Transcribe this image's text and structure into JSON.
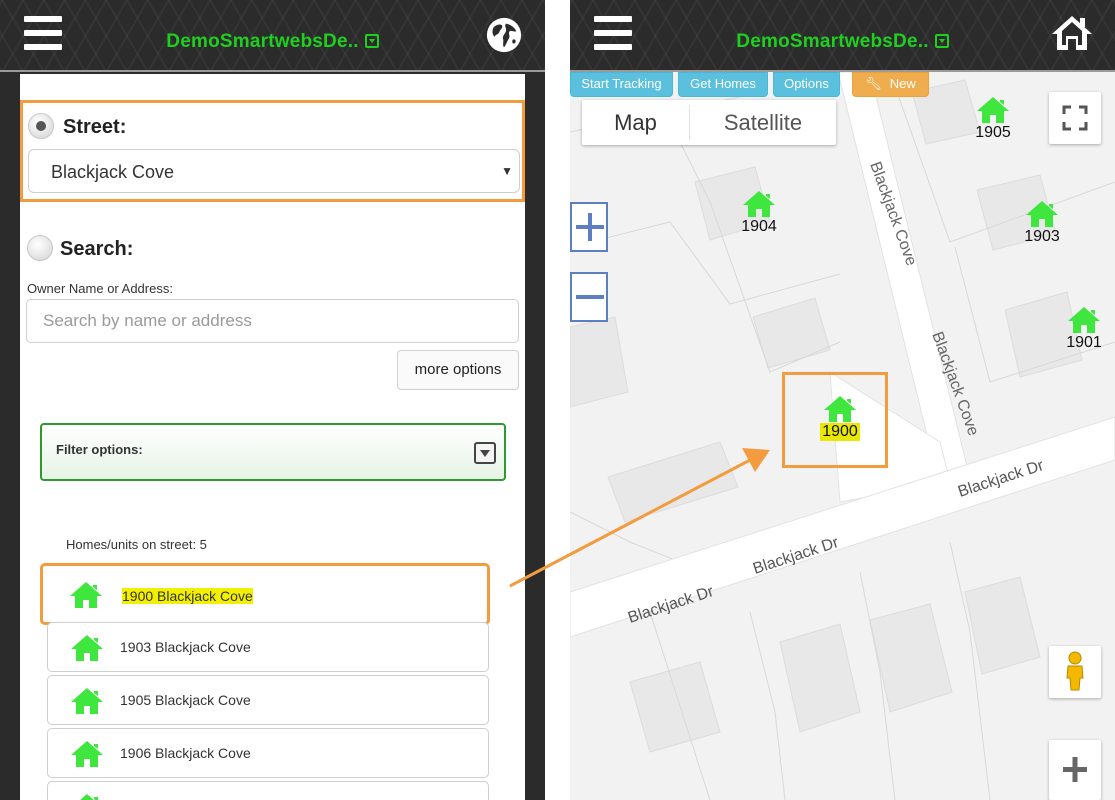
{
  "left": {
    "header": {
      "title": "DemoSmartwebsDe.."
    },
    "street": {
      "label": "Street:",
      "selected_value": "Blackjack Cove"
    },
    "search": {
      "label": "Search:",
      "field_label": "Owner Name or Address:",
      "placeholder": "Search by name or address",
      "more_options_label": "more options"
    },
    "filter": {
      "label": "Filter options:"
    },
    "homes_count_text": "Homes/units on street: 5",
    "homes": [
      {
        "address": "1900 Blackjack Cove",
        "selected": true
      },
      {
        "address": "1903 Blackjack Cove",
        "selected": false
      },
      {
        "address": "1905 Blackjack Cove",
        "selected": false
      },
      {
        "address": "1906 Blackjack Cove",
        "selected": false
      }
    ]
  },
  "right": {
    "header": {
      "title": "DemoSmartwebsDe.."
    },
    "toolbar": {
      "start_tracking": "Start Tracking",
      "get_homes": "Get Homes",
      "options": "Options",
      "new": "New"
    },
    "map_type": {
      "map": "Map",
      "satellite": "Satellite"
    },
    "street_labels": {
      "cove_upper": "Blackjack Cove",
      "cove_lower": "Blackjack Cove",
      "dr_right": "Blackjack Dr",
      "dr_mid": "Blackjack Dr",
      "dr_left": "Blackjack Dr"
    },
    "markers": [
      {
        "number": "1905",
        "highlighted": false
      },
      {
        "number": "1904",
        "highlighted": false
      },
      {
        "number": "1903",
        "highlighted": false
      },
      {
        "number": "1901",
        "highlighted": false
      },
      {
        "number": "1900",
        "highlighted": true
      }
    ]
  },
  "colors": {
    "brand_green": "#1fcf1f",
    "house_green": "#3ee63e",
    "highlight_yellow": "#f2f000",
    "annotation_orange": "#f29b3f",
    "filter_border": "#2e9a2e",
    "button_blue": "#5bc0de",
    "button_orange": "#f0ad4e"
  },
  "icons": [
    "hamburger-menu-icon",
    "globe-icon",
    "home-icon",
    "house-icon",
    "wrench-icon",
    "fullscreen-icon",
    "pegman-icon",
    "zoom-in-icon",
    "zoom-out-icon",
    "plus-icon",
    "chevron-down-icon"
  ]
}
